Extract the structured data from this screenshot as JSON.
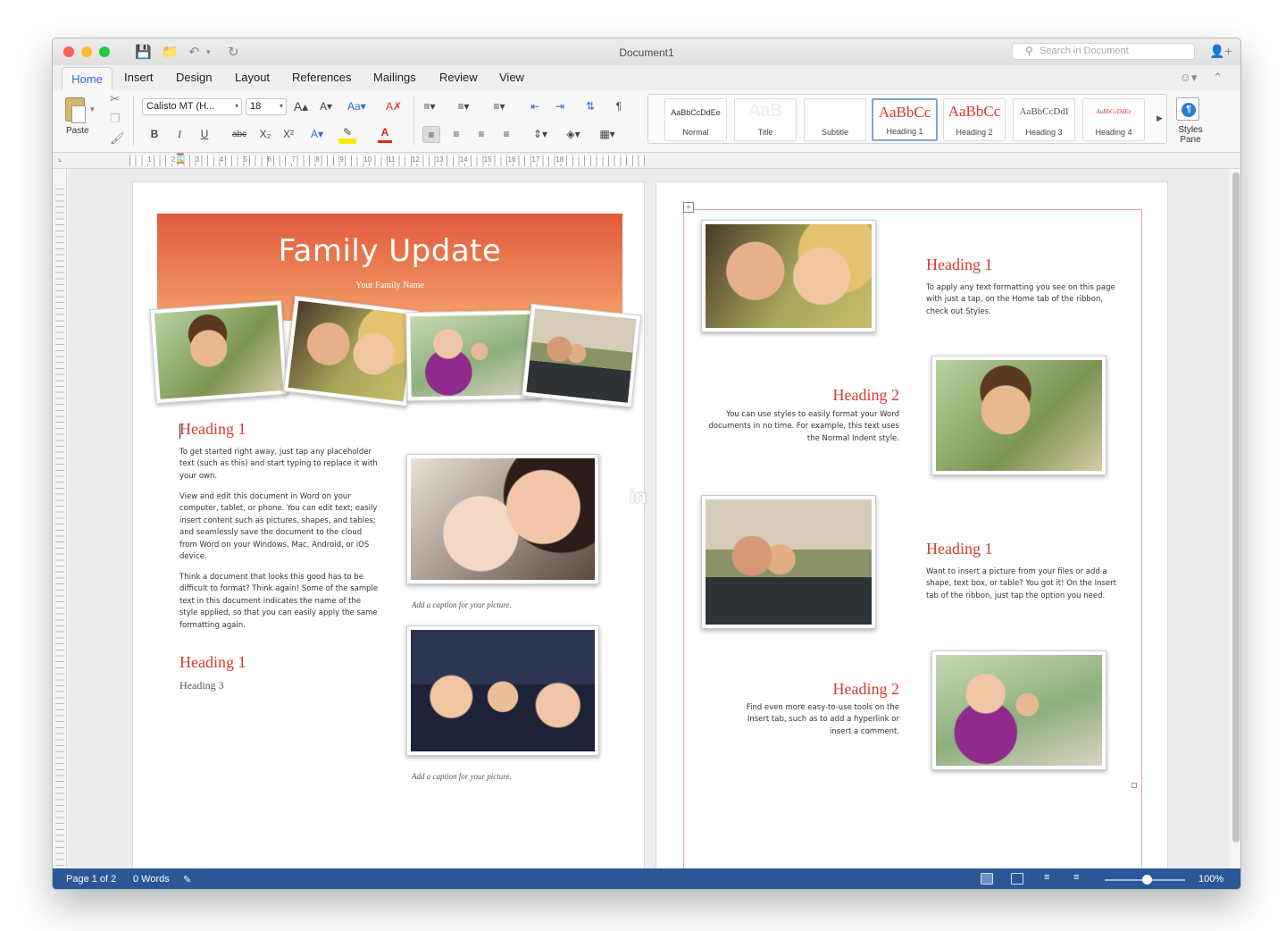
{
  "window": {
    "title": "Document1",
    "search_placeholder": "Search in Document"
  },
  "tabs": [
    "Home",
    "Insert",
    "Design",
    "Layout",
    "References",
    "Mailings",
    "Review",
    "View"
  ],
  "ribbon": {
    "paste_label": "Paste",
    "font_name": "Calisto MT (H...",
    "font_size": "18",
    "format_buttons": {
      "bold": "B",
      "italic": "I",
      "underline": "U",
      "strike": "abc",
      "subscript": "X₂",
      "superscript": "X²"
    },
    "styles": [
      {
        "preview": "AaBbCcDdEe",
        "name": "Normal",
        "color": "#222222"
      },
      {
        "preview": "AaB",
        "name": "Title",
        "color": "#eeeeee"
      },
      {
        "preview": "",
        "name": "Subtitle",
        "color": "#999999"
      },
      {
        "preview": "AaBbCc",
        "name": "Heading 1",
        "color": "#d6392d"
      },
      {
        "preview": "AaBbCc",
        "name": "Heading 2",
        "color": "#d6392d"
      },
      {
        "preview": "AaBbCcDdI",
        "name": "Heading 3",
        "color": "#555555"
      },
      {
        "preview": "AaBbCcDdEe",
        "name": "Heading 4",
        "color": "#d6392d"
      }
    ],
    "styles_pane_label": "Styles Pane"
  },
  "ruler": {
    "numbers": [
      "1",
      "2",
      "3",
      "4",
      "5",
      "6",
      "7",
      "8",
      "9",
      "10",
      "11",
      "12",
      "13",
      "14",
      "15",
      "16",
      "17",
      "18"
    ]
  },
  "page1": {
    "banner_title": "Family Update",
    "banner_subtitle": "Your Family Name",
    "heading_a": "Heading 1",
    "para1": "To get started right away, just tap any placeholder text (such as this) and start typing to replace it with your own.",
    "para2": "View and edit this document in Word on your computer, tablet, or phone. You can edit text; easily insert content such as pictures, shapes, and tables; and seamlessly save the document to the cloud from Word on your Windows, Mac, Android, or iOS device.",
    "para3": "Think a document that looks this good has to be difficult to format? Think again! Some of the sample text in this document indicates the name of the style applied, so that you can easily apply the same formatting again.",
    "heading_b": "Heading 1",
    "heading3": "Heading 3",
    "caption1": "Add a caption for your picture.",
    "caption2": "Add a caption for your picture."
  },
  "page2": {
    "block1_heading": "Heading 1",
    "block1_text": "To apply any text formatting you see on this page with just a tap, on the Home tab of the ribbon, check out Styles.",
    "block2_heading": "Heading 2",
    "block2_text": "You can use styles to easily format your Word documents in no time. For example, this text uses the Normal Indent style.",
    "block3_heading": "Heading 1",
    "block3_text": "Want to insert a picture from your files or add a shape, text box, or table? You got it! On the Insert tab of the ribbon, just tap the option you need.",
    "block4_heading": "Heading 2",
    "block4_text": "Find even more easy-to-use tools on the Insert tab, such as to add a hyperlink or insert a comment."
  },
  "watermark": "in",
  "status": {
    "page": "Page 1 of 2",
    "words": "0 Words",
    "zoom": "100%"
  },
  "icons": [
    "close-light",
    "minimize-light",
    "zoom-light",
    "save-icon",
    "open-icon",
    "undo-icon",
    "redo-icon",
    "search-icon",
    "share-icon",
    "smiley-icon",
    "collapse-ribbon-icon",
    "cut-icon",
    "copy-icon",
    "format-painter-icon",
    "bullets-icon",
    "numbering-icon",
    "indent-icon",
    "sort-icon",
    "pilcrow-icon",
    "align-left-icon",
    "align-center-icon",
    "align-right-icon",
    "justify-icon",
    "line-spacing-icon",
    "shading-icon",
    "borders-icon",
    "styles-pane-icon",
    "print-layout-icon",
    "web-layout-icon",
    "outline-icon",
    "draft-icon"
  ],
  "colors": {
    "accent_blue": "#2b6cd4",
    "status_bar": "#2b5797",
    "heading_red": "#d6392d",
    "banner_top": "#e05a39",
    "banner_bottom": "#f4a06a"
  }
}
